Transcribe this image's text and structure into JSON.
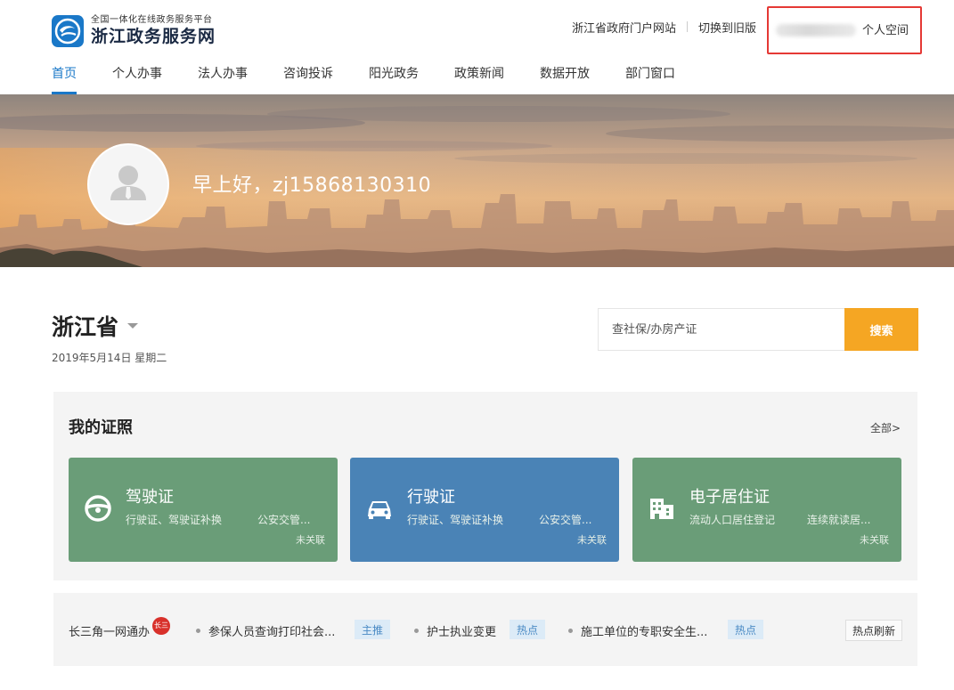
{
  "header": {
    "logo_subtitle": "全国一体化在线政务服务平台",
    "logo_title": "浙江政务服务网",
    "links": [
      "浙江省政府门户网站",
      "切换到旧版"
    ],
    "user_space": "个人空间"
  },
  "nav": {
    "items": [
      "首页",
      "个人办事",
      "法人办事",
      "咨询投诉",
      "阳光政务",
      "政策新闻",
      "数据开放",
      "部门窗口"
    ],
    "active": "首页"
  },
  "banner": {
    "greeting": "早上好，zj15868130310"
  },
  "region": {
    "name": "浙江省",
    "date": "2019年5月14日 星期二"
  },
  "search": {
    "placeholder": "查社保/办房产证",
    "button": "搜索",
    "accent": "#f5a623"
  },
  "licenses": {
    "title": "我的证照",
    "all_link": "全部>",
    "cards": [
      {
        "title": "驾驶证",
        "sub1": "行驶证、驾驶证补换",
        "sub2": "公安交管...",
        "status": "未关联",
        "icon": "steering-wheel-icon",
        "color": "#6a9d78"
      },
      {
        "title": "行驶证",
        "sub1": "行驶证、驾驶证补换",
        "sub2": "公安交管...",
        "status": "未关联",
        "icon": "car-icon",
        "color": "#4a83b6"
      },
      {
        "title": "电子居住证",
        "sub1": "流动人口居住登记",
        "sub2": "连续就读居...",
        "status": "未关联",
        "icon": "building-icon",
        "color": "#6a9d78"
      }
    ]
  },
  "hot": {
    "brand": "长三角一网通办",
    "brand_badge": "长三",
    "items": [
      {
        "text": "参保人员查询打印社会...",
        "tag": "主推"
      },
      {
        "text": "护士执业变更",
        "tag": "热点"
      },
      {
        "text": "施工单位的专职安全生...",
        "tag": "热点"
      }
    ],
    "refresh": "热点刷新"
  }
}
